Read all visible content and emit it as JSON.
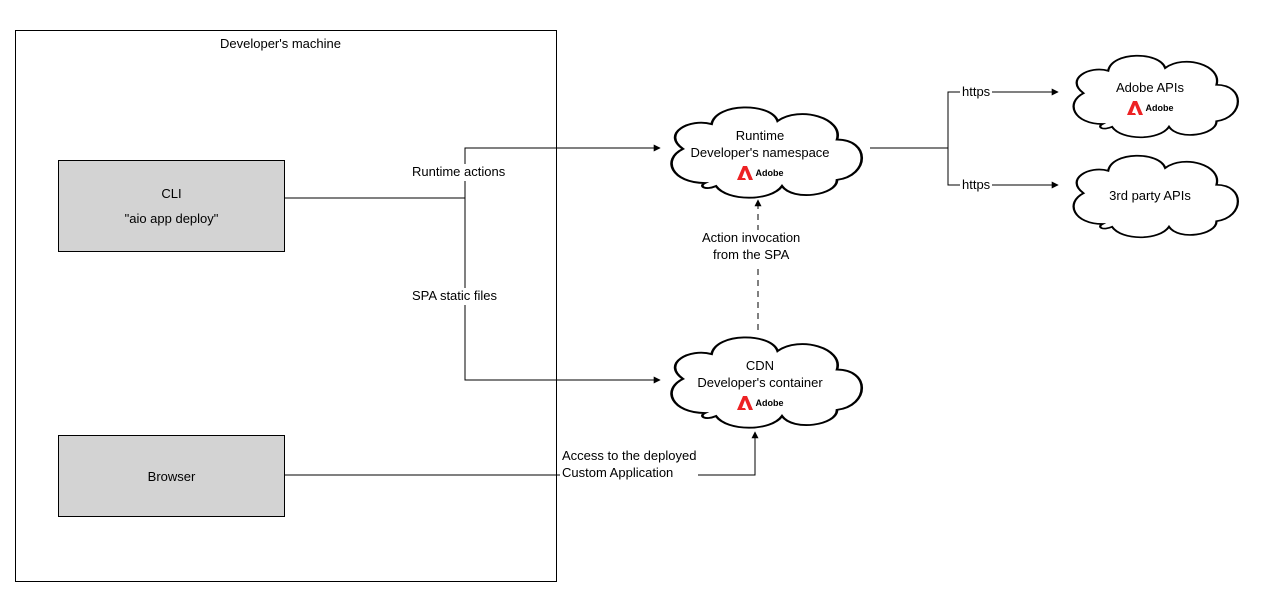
{
  "container_title": "Developer's machine",
  "nodes": {
    "cli": {
      "title": "CLI",
      "subtitle": "\"aio app deploy\""
    },
    "browser": {
      "title": "Browser"
    },
    "runtime": {
      "line1": "Runtime",
      "line2": "Developer's namespace"
    },
    "cdn": {
      "line1": "CDN",
      "line2": "Developer's container"
    },
    "adobe_apis": {
      "line1": "Adobe APIs"
    },
    "third_party": {
      "line1": "3rd party APIs"
    }
  },
  "edges": {
    "runtime_actions": "Runtime actions",
    "spa_files": "SPA static files",
    "access_app_l1": "Access to the deployed",
    "access_app_l2": "Custom Application",
    "action_invocation_l1": "Action invocation",
    "action_invocation_l2": "from the SPA",
    "https1": "https",
    "https2": "https"
  },
  "adobe_brand": "Adobe"
}
